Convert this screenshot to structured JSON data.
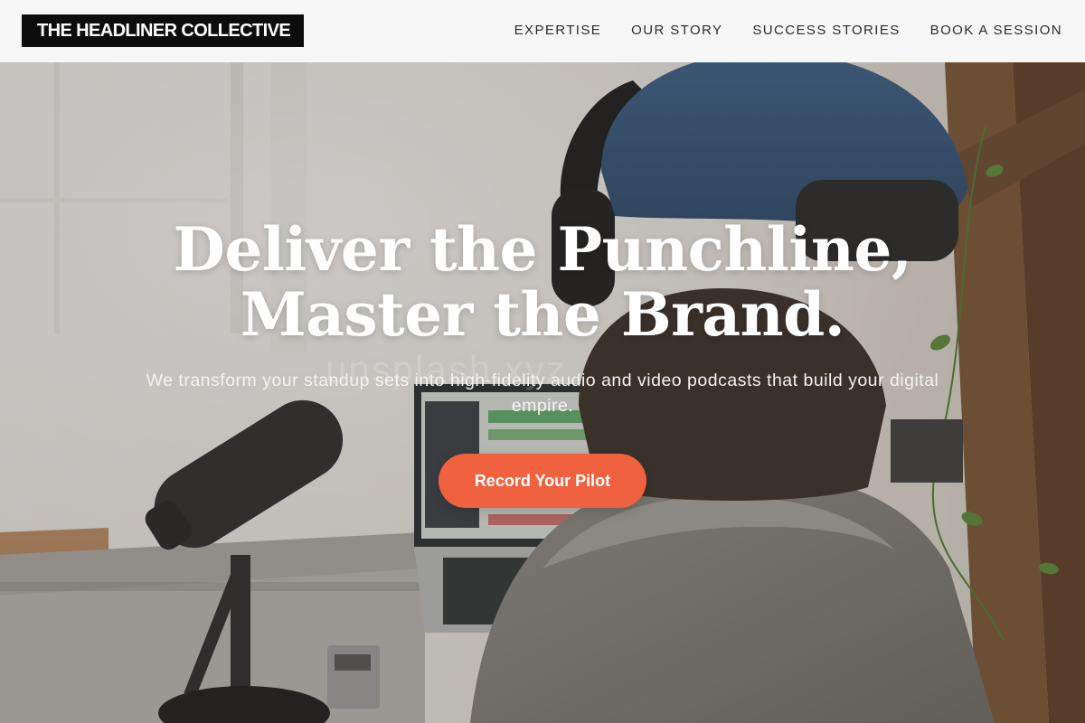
{
  "header": {
    "logo_text": "THE HEADLINER COLLECTIVE",
    "nav": [
      {
        "label": "EXPERTISE"
      },
      {
        "label": "OUR STORY"
      },
      {
        "label": "SUCCESS STORIES"
      },
      {
        "label": "BOOK A SESSION"
      }
    ]
  },
  "hero": {
    "title_line1": "Deliver the Punchline,",
    "title_line2": "Master the Brand.",
    "subtitle": "We transform your standup sets into high-fidelity audio and video podcasts that build your digital empire.",
    "cta_label": "Record Your Pilot",
    "watermark": "unsplash.xyz",
    "image": "podcast-studio-photo"
  },
  "colors": {
    "accent": "#f0613f",
    "logo_bg": "#0d0d0d",
    "header_bg": "#f8f8f8"
  }
}
